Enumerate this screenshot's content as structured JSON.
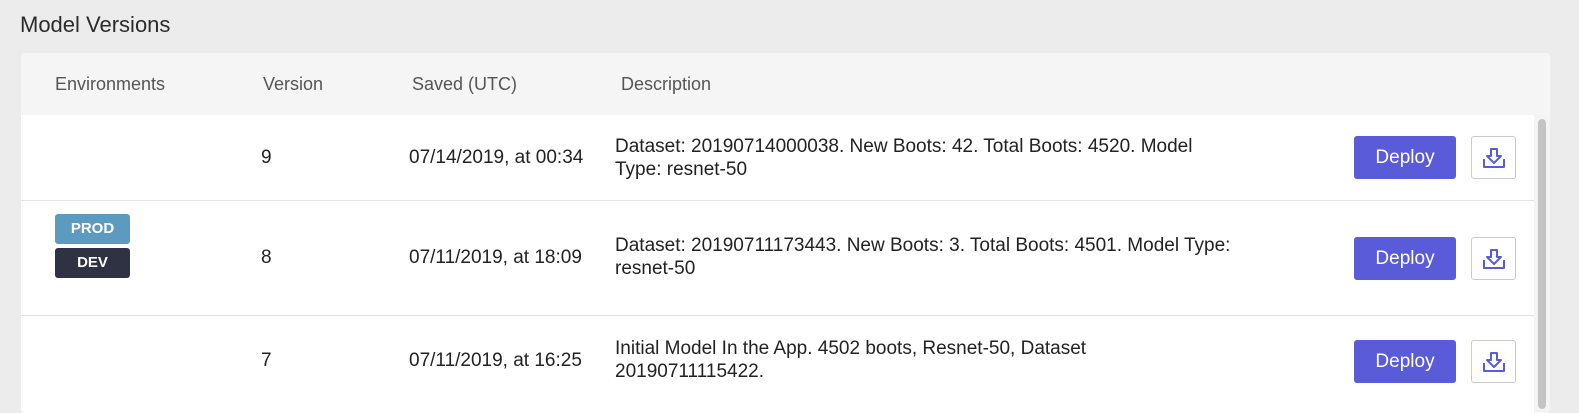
{
  "page": {
    "title": "Model Versions"
  },
  "table": {
    "headers": {
      "environments": "Environments",
      "version": "Version",
      "saved": "Saved (UTC)",
      "description": "Description"
    },
    "rows": [
      {
        "environments": [],
        "version": "9",
        "saved": "07/14/2019, at 00:34",
        "description": "Dataset: 20190714000038. New Boots: 42. Total Boots: 4520. Model Type: resnet-50",
        "deploy_label": "Deploy"
      },
      {
        "environments": [
          "PROD",
          "DEV"
        ],
        "version": "8",
        "saved": "07/11/2019, at 18:09",
        "description": "Dataset: 20190711173443. New Boots: 3. Total Boots: 4501. Model Type: resnet-50",
        "deploy_label": "Deploy"
      },
      {
        "environments": [],
        "version": "7",
        "saved": "07/11/2019, at 16:25",
        "description": "Initial Model In the App. 4502 boots, Resnet-50, Dataset 20190711115422.",
        "deploy_label": "Deploy"
      }
    ]
  },
  "icons": {
    "download": "download-icon"
  },
  "colors": {
    "deploy_button": "#5a5bd8",
    "prod_badge": "#5c9bbf",
    "dev_badge": "#2f3242",
    "download_icon": "#5a5bd8"
  }
}
